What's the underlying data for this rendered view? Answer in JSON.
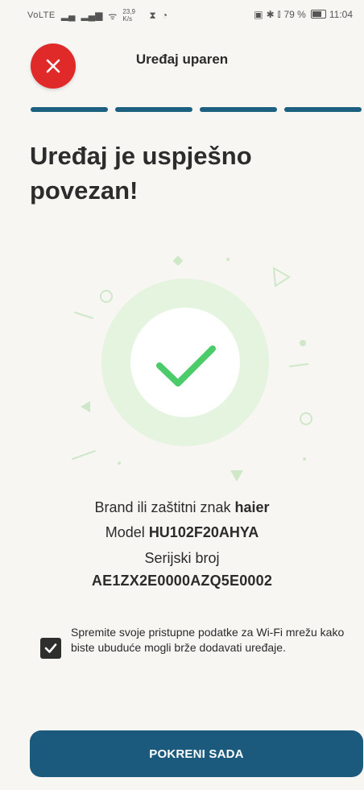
{
  "status_bar": {
    "left_chip": "VoLTE",
    "speed": "23,9 K/s",
    "right_battery": "79 %",
    "time": "11:04"
  },
  "header": {
    "title": "Uređaj uparen",
    "close_icon": "close-icon"
  },
  "progress": {
    "total_steps": 4,
    "completed_steps": 4
  },
  "headline": "Uređaj je uspješno povezan!",
  "device": {
    "brand_label": "Brand ili zaštitni znak",
    "brand_value": "haier",
    "model_label": "Model",
    "model_value": "HU102F20AHYA",
    "serial_label": "Serijski broj",
    "serial_value": "AE1ZX2E0000AZQ5E0002"
  },
  "save_wifi": {
    "checked": true,
    "text": "Spremite svoje pristupne podatke za Wi-Fi mrežu kako biste ubuduće mogli brže dodavati uređaje."
  },
  "primary_button": {
    "label": "POKRENI SADA"
  },
  "colors": {
    "accent": "#1b5a7c",
    "close": "#e02a2a",
    "success": "#4ccb6b",
    "background": "#f7f6f3"
  }
}
